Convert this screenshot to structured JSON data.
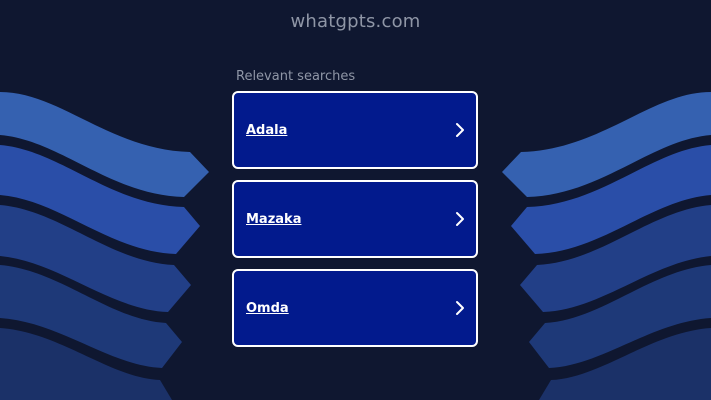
{
  "header": {
    "domain": "whatgpts.com"
  },
  "related": {
    "label": "Relevant searches",
    "items": [
      {
        "label": "Adala",
        "icon": "chevron-right-icon"
      },
      {
        "label": "Mazaka",
        "icon": "chevron-right-icon"
      },
      {
        "label": "Omda",
        "icon": "chevron-right-icon"
      }
    ]
  },
  "colors": {
    "background": "#0f1730",
    "card": "#021a8d",
    "card_border": "#ffffff",
    "muted_text": "#8f96a6",
    "wave_light": "#3561b0",
    "wave_mid": "#2a4ea8",
    "wave_dark": "#1e3978"
  }
}
